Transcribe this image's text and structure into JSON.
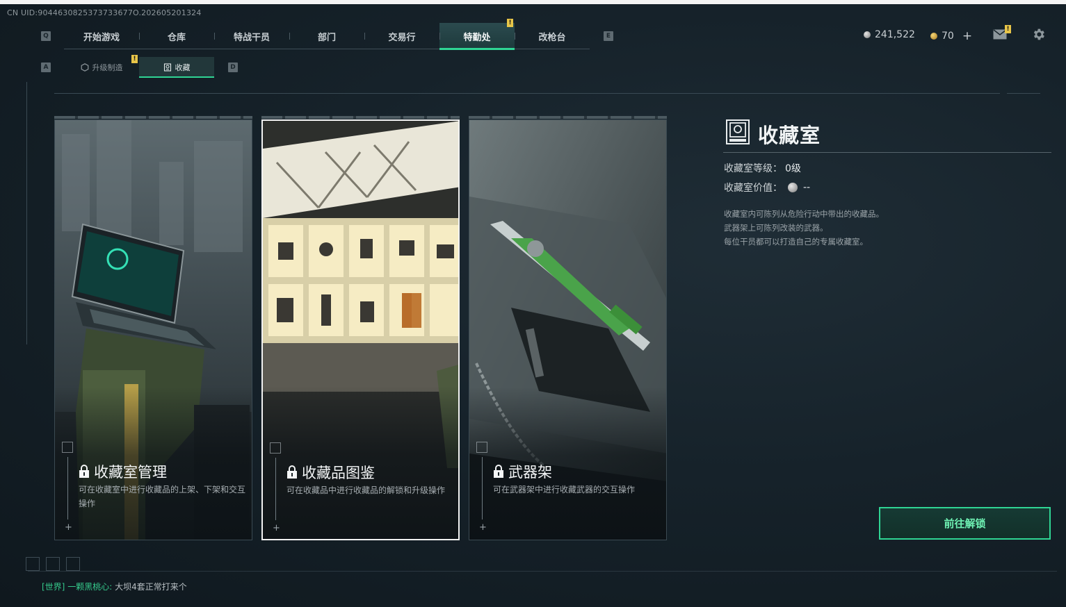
{
  "uid_text": "CN UID:9044630825373733677O.202605201324",
  "key_hints": {
    "prev_main": "Q",
    "next_main": "E",
    "prev_sub": "A",
    "next_sub": "D"
  },
  "main_tabs": [
    {
      "label": "开始游戏",
      "active": false
    },
    {
      "label": "仓库",
      "active": false
    },
    {
      "label": "特战干员",
      "active": false
    },
    {
      "label": "部门",
      "active": false
    },
    {
      "label": "交易行",
      "active": false
    },
    {
      "label": "特勤处",
      "active": true,
      "alert": "!"
    },
    {
      "label": "改枪台",
      "active": false
    }
  ],
  "currency": {
    "silver": "241,522",
    "gold": "70",
    "add": "+"
  },
  "mail_alert": "!",
  "sub_tabs": [
    {
      "label": "升级制造",
      "alert": "!",
      "icon": "hexagon-icon"
    },
    {
      "label": "收藏",
      "icon": "trophy-icon"
    }
  ],
  "cards": [
    {
      "title": "收藏室管理",
      "desc": "可在收藏室中进行收藏品的上架、下架和交互操作",
      "locked": true
    },
    {
      "title": "收藏品图鉴",
      "desc": "可在收藏品中进行收藏品的解锁和升级操作",
      "locked": true,
      "selected": true
    },
    {
      "title": "武器架",
      "desc": "可在武器架中进行收藏武器的交互操作",
      "locked": true
    }
  ],
  "panel": {
    "title": "收藏室",
    "level_label": "收藏室等级：",
    "level_value": "0级",
    "worth_label": "收藏室价值：",
    "worth_value": "--",
    "desc": [
      "收藏室内可陈列从危险行动中带出的收藏品。",
      "武器架上可陈列改装的武器。",
      "每位干员都可以打造自己的专属收藏室。"
    ]
  },
  "unlock_button": "前往解锁",
  "chat": {
    "channel": "[世界]",
    "sender": "一颗黑桃心:",
    "message": "大坝4套正常打来个"
  },
  "colors": {
    "accent": "#2fd594",
    "alert": "#e8c548",
    "bg": "#16222a"
  }
}
